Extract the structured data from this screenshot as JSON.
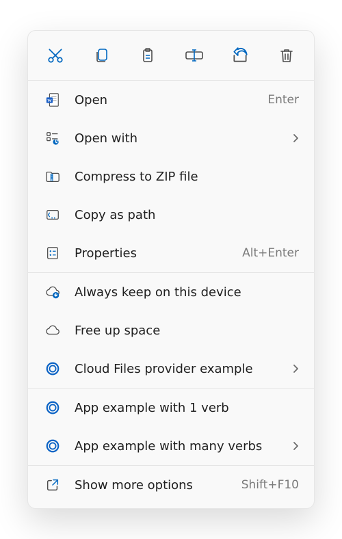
{
  "toolbar": {
    "cut": "Cut",
    "copy": "Copy",
    "paste": "Paste",
    "rename": "Rename",
    "share": "Share",
    "delete": "Delete"
  },
  "group1": {
    "open": {
      "label": "Open",
      "accel": "Enter"
    },
    "open_with": {
      "label": "Open with"
    },
    "compress": {
      "label": "Compress to ZIP file"
    },
    "copy_path": {
      "label": "Copy as path"
    },
    "properties": {
      "label": "Properties",
      "accel": "Alt+Enter"
    }
  },
  "group2": {
    "keep": {
      "label": "Always keep on this device"
    },
    "free": {
      "label": "Free up space"
    },
    "cloud_provider": {
      "label": "Cloud Files provider example"
    }
  },
  "group3": {
    "app1": {
      "label": "App example with 1 verb"
    },
    "app_many": {
      "label": "App example with many verbs"
    }
  },
  "group4": {
    "more": {
      "label": "Show more options",
      "accel": "Shift+F10"
    }
  },
  "colors": {
    "accent": "#0067c0",
    "icon_neutral": "#4c4c4c"
  }
}
